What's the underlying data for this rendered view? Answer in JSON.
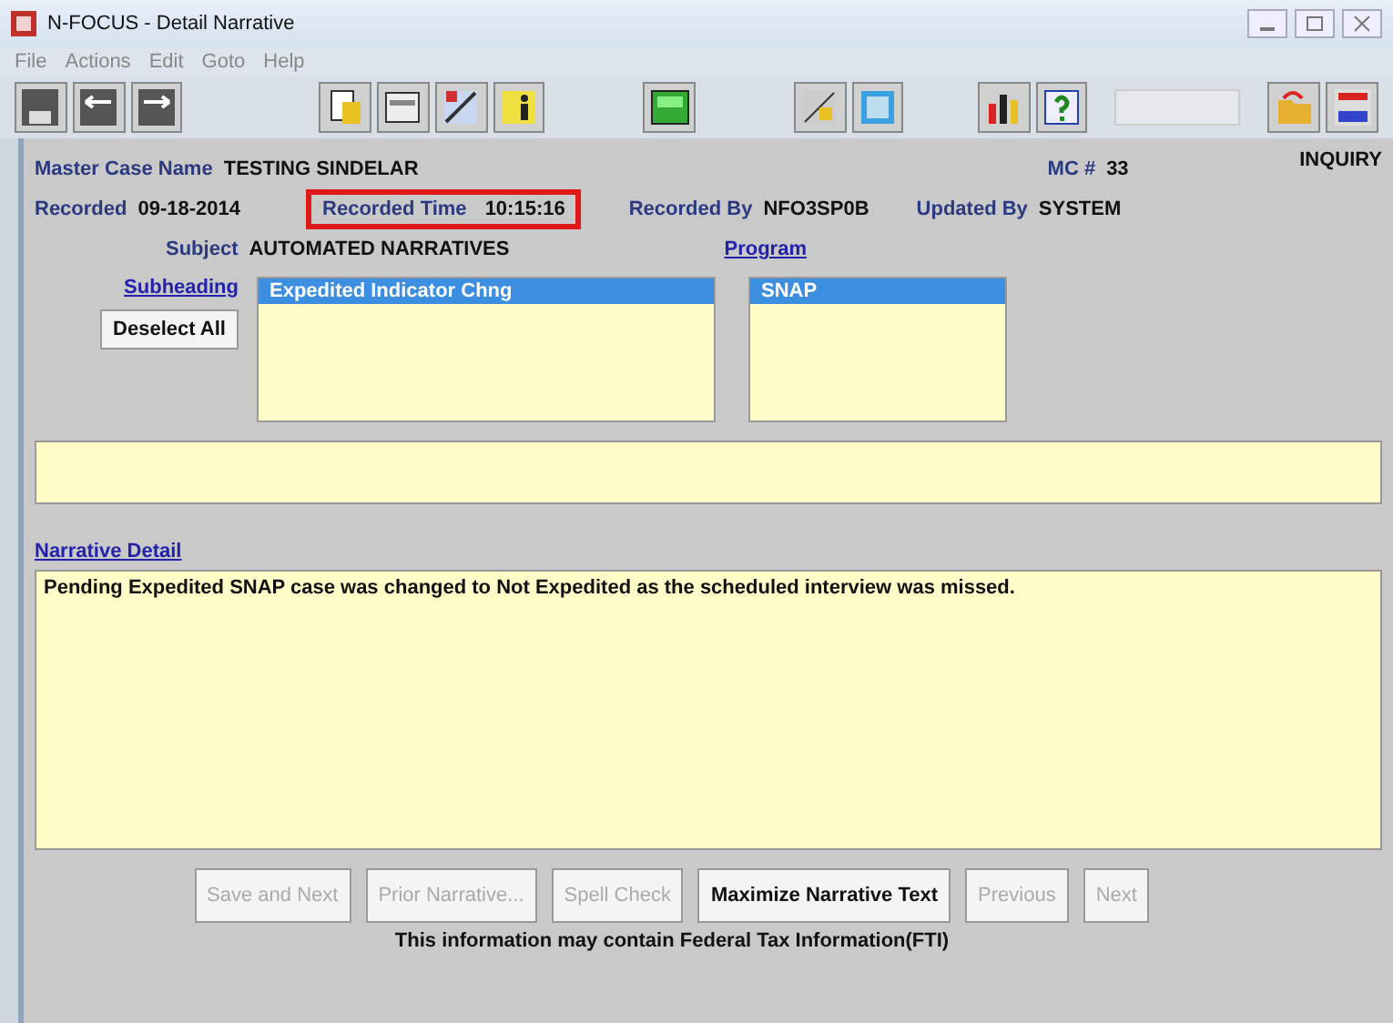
{
  "window": {
    "title": "N-FOCUS - Detail Narrative"
  },
  "menu": [
    "File",
    "Actions",
    "Edit",
    "Goto",
    "Help"
  ],
  "header": {
    "mode": "INQUIRY",
    "master_case_name": {
      "label": "Master Case Name",
      "value": "TESTING SINDELAR"
    },
    "mc": {
      "label": "MC #",
      "value": "33"
    },
    "recorded": {
      "label": "Recorded",
      "value": "09-18-2014"
    },
    "recorded_time": {
      "label": "Recorded Time",
      "value": "10:15:16",
      "highlighted": true
    },
    "recorded_by": {
      "label": "Recorded By",
      "value": "NFO3SP0B"
    },
    "updated_by": {
      "label": "Updated By",
      "value": "SYSTEM"
    },
    "subject": {
      "label": "Subject",
      "value": "AUTOMATED NARRATIVES"
    }
  },
  "subheading": {
    "label": "Subheading",
    "button": "Deselect All",
    "items": [
      {
        "text": "Expedited Indicator Chng",
        "selected": true
      }
    ]
  },
  "program": {
    "label": "Program",
    "items": [
      {
        "text": "SNAP",
        "selected": true
      }
    ]
  },
  "narrative": {
    "label": "Narrative Detail",
    "text": "Pending Expedited SNAP case was changed to Not Expedited as the scheduled interview was missed."
  },
  "buttons": [
    {
      "label": "Save and Next",
      "disabled": true
    },
    {
      "label": "Prior Narrative...",
      "disabled": true
    },
    {
      "label": "Spell Check",
      "disabled": true
    },
    {
      "label": "Maximize Narrative Text",
      "disabled": false
    },
    {
      "label": "Previous",
      "disabled": true
    },
    {
      "label": "Next",
      "disabled": true
    }
  ],
  "footer": "This information may contain Federal Tax Information(FTI)"
}
